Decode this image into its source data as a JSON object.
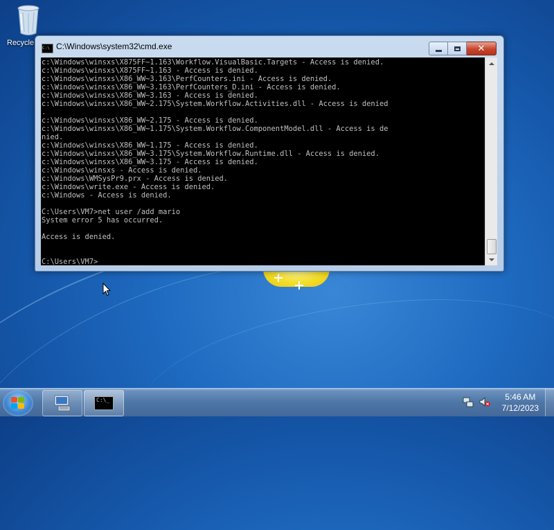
{
  "desktop": {
    "icons": [
      {
        "label": "Recycle",
        "icon": "recycle-bin-icon"
      }
    ]
  },
  "window": {
    "title": "C:\\Windows\\system32\\cmd.exe",
    "icon": "cmd-icon",
    "icon_text": "C:\\",
    "buttons": {
      "minimize": "minimize-icon",
      "maximize": "maximize-icon",
      "close": "close-icon"
    },
    "console_lines": [
      "c:\\Windows\\winsxs\\X875FF~1.163\\Workflow.VisualBasic.Targets - Access is denied.",
      "c:\\Windows\\winsxs\\X875FF~1.163 - Access is denied.",
      "c:\\Windows\\winsxs\\X86_WW~3.163\\PerfCounters.ini - Access is denied.",
      "c:\\Windows\\winsxs\\X86_WW~3.163\\PerfCounters_D.ini - Access is denied.",
      "c:\\Windows\\winsxs\\X86_WW~3.163 - Access is denied.",
      "c:\\Windows\\winsxs\\X86_WW~2.175\\System.Workflow.Activities.dll - Access is denied",
      ".",
      "c:\\Windows\\winsxs\\X86_WW~2.175 - Access is denied.",
      "c:\\Windows\\winsxs\\X86_WW~1.175\\System.Workflow.ComponentModel.dll - Access is de",
      "nied.",
      "c:\\Windows\\winsxs\\X86_WW~1.175 - Access is denied.",
      "c:\\Windows\\winsxs\\X86_WW~3.175\\System.Workflow.Runtime.dll - Access is denied.",
      "c:\\Windows\\winsxs\\X86_WW~3.175 - Access is denied.",
      "c:\\Windows\\winsxs - Access is denied.",
      "c:\\Windows\\WMSysPr9.prx - Access is denied.",
      "c:\\Windows\\write.exe - Access is denied.",
      "c:\\Windows - Access is denied.",
      "",
      "C:\\Users\\VM7>net user /add mario",
      "System error 5 has occurred.",
      "",
      "Access is denied.",
      "",
      "",
      "C:\\Users\\VM7>"
    ]
  },
  "taskbar": {
    "start_icon": "windows-start-icon",
    "pinned": [
      {
        "icon": "server-manager-icon"
      },
      {
        "icon": "cmd-icon",
        "text": "C:\\_"
      }
    ],
    "tray": {
      "icons": [
        "network-icon",
        "volume-muted-icon"
      ],
      "time": "5:46 AM",
      "date": "7/12/2023"
    }
  },
  "colors": {
    "console_bg": "#000000",
    "console_fg": "#c0c0c0",
    "close_button": "#c7452c"
  }
}
